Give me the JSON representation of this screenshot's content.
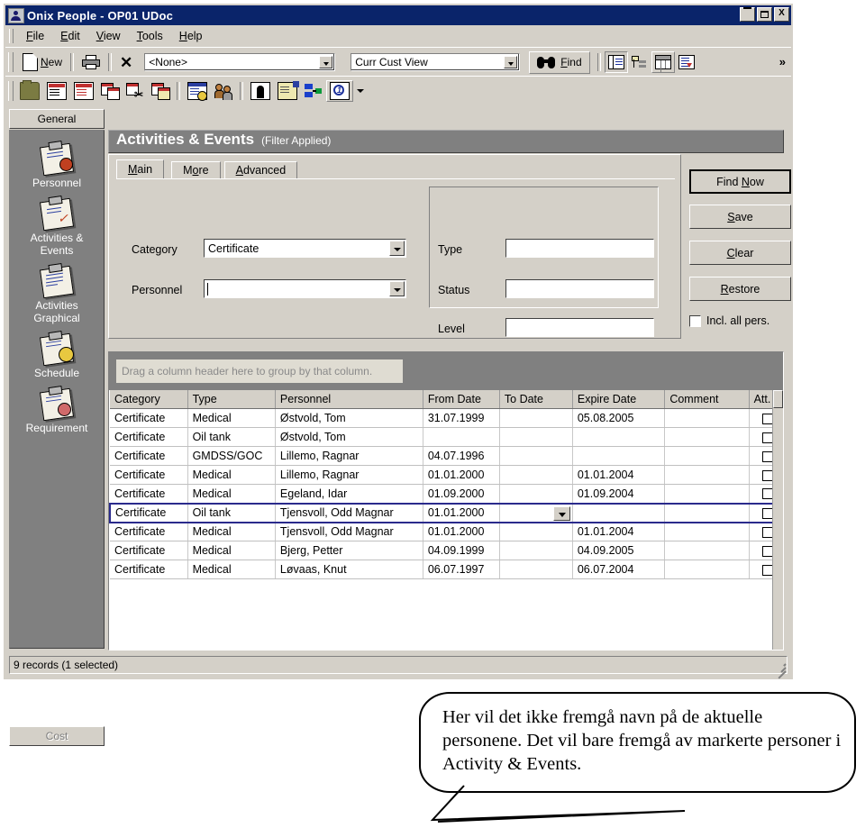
{
  "window": {
    "title": "Onix People - OP01 UDoc",
    "icon": "person-card-icon",
    "buttons": {
      "minimize": "_",
      "maximize": "□",
      "close": "X"
    }
  },
  "menubar": [
    {
      "label": "File",
      "accel": "F"
    },
    {
      "label": "Edit",
      "accel": "E"
    },
    {
      "label": "View",
      "accel": "V"
    },
    {
      "label": "Tools",
      "accel": "T"
    },
    {
      "label": "Help",
      "accel": "H"
    }
  ],
  "toolbar1": {
    "new_label": "New",
    "new_accel": "N",
    "print_icon": "printer-icon",
    "delete_icon": "delete-x-icon",
    "filter_combo": {
      "value": "<None>"
    },
    "view_combo": {
      "value": "Curr Cust View"
    },
    "find_label": "Find",
    "find_accel": "F",
    "find_icon": "binoculars-icon",
    "view_buttons": [
      {
        "name": "detail-view-icon"
      },
      {
        "name": "tree-view-icon"
      },
      {
        "name": "grid-view-icon"
      },
      {
        "name": "sort-view-icon"
      }
    ],
    "overflow": "»"
  },
  "toolbar2": {
    "icons": [
      "open-folder-icon",
      "document-icon",
      "document-red-icon",
      "copy-documents-icon",
      "cut-documents-icon",
      "paste-documents-icon",
      "calendar-clock-icon",
      "people-group-icon",
      "portrait-icon",
      "note-flag-icon",
      "link-blocks-icon",
      "info-circle-icon",
      "dropdown-caret-icon"
    ]
  },
  "sidebar": {
    "header": "General",
    "footer": "Cost",
    "items": [
      {
        "label": "Personnel",
        "icon": "clipboard-person-icon"
      },
      {
        "label": "Activities &\nEvents",
        "icon": "clipboard-check-icon"
      },
      {
        "label": "Activities\nGraphical",
        "icon": "clipboard-lines-icon"
      },
      {
        "label": "Schedule",
        "icon": "clipboard-clock-icon"
      },
      {
        "label": "Requirement",
        "icon": "clipboard-stamp-icon"
      }
    ]
  },
  "panel": {
    "title": "Activities & Events",
    "subtitle": "(Filter Applied)"
  },
  "filter": {
    "tabs": [
      {
        "label": "Main",
        "accel": "M",
        "active": true
      },
      {
        "label": "More",
        "accel": "o",
        "active": false
      },
      {
        "label": "Advanced",
        "accel": "A",
        "active": false
      }
    ],
    "fields": [
      {
        "name": "category",
        "label": "Category",
        "value": "Certificate",
        "type": "combo"
      },
      {
        "name": "personnel",
        "label": "Personnel",
        "value": "",
        "type": "combo"
      },
      {
        "name": "type",
        "label": "Type",
        "value": "",
        "type": "text"
      },
      {
        "name": "status",
        "label": "Status",
        "value": "",
        "type": "text"
      },
      {
        "name": "level",
        "label": "Level",
        "value": "",
        "type": "text"
      }
    ],
    "buttons": [
      {
        "name": "find-now",
        "label": "Find Now",
        "accel": "N",
        "default": true
      },
      {
        "name": "save",
        "label": "Save",
        "accel": "S",
        "default": false
      },
      {
        "name": "clear",
        "label": "Clear",
        "accel": "C",
        "default": false
      },
      {
        "name": "restore",
        "label": "Restore",
        "accel": "R",
        "default": false
      }
    ],
    "checkbox": {
      "label": "Incl. all pers.",
      "checked": false
    }
  },
  "grid": {
    "group_hint": "Drag a column header here to group by that column.",
    "columns": [
      "Category",
      "Type",
      "Personnel",
      "From Date",
      "To Date",
      "Expire Date",
      "Comment",
      "Att."
    ],
    "rows": [
      {
        "cells": [
          "Certificate",
          "Medical",
          "Østvold, Tom",
          "31.07.1999",
          "",
          "05.08.2005",
          ""
        ],
        "selected": false
      },
      {
        "cells": [
          "Certificate",
          "Oil tank",
          "Østvold, Tom",
          "",
          "",
          "",
          ""
        ],
        "selected": false
      },
      {
        "cells": [
          "Certificate",
          "GMDSS/GOC",
          "Lillemo, Ragnar",
          "04.07.1996",
          "",
          "",
          ""
        ],
        "selected": false
      },
      {
        "cells": [
          "Certificate",
          "Medical",
          "Lillemo, Ragnar",
          "01.01.2000",
          "",
          "01.01.2004",
          ""
        ],
        "selected": false
      },
      {
        "cells": [
          "Certificate",
          "Medical",
          "Egeland, Idar",
          "01.09.2000",
          "",
          "01.09.2004",
          ""
        ],
        "selected": false
      },
      {
        "cells": [
          "Certificate",
          "Oil tank",
          "Tjensvoll, Odd Magnar",
          "01.01.2000",
          "",
          "",
          ""
        ],
        "selected": true
      },
      {
        "cells": [
          "Certificate",
          "Medical",
          "Tjensvoll, Odd Magnar",
          "01.01.2000",
          "",
          "01.01.2004",
          ""
        ],
        "selected": false
      },
      {
        "cells": [
          "Certificate",
          "Medical",
          "Bjerg, Petter",
          "04.09.1999",
          "",
          "04.09.2005",
          ""
        ],
        "selected": false
      },
      {
        "cells": [
          "Certificate",
          "Medical",
          "Løvaas, Knut",
          "06.07.1997",
          "",
          "06.07.2004",
          ""
        ],
        "selected": false
      }
    ]
  },
  "statusbar": {
    "text": "9 records (1 selected)"
  },
  "callout": {
    "text": "Her vil det ikke fremgå navn på de aktuelle personene. Det vil bare fremgå av markerte personer i Activity & Events."
  },
  "colors": {
    "titlebar": "#0a246a",
    "window_face": "#d4d0c8",
    "sidebar_bg": "#808080",
    "panel_header": "#808080",
    "selection_border": "#2a2a8c",
    "field_white": "#ffffff"
  }
}
